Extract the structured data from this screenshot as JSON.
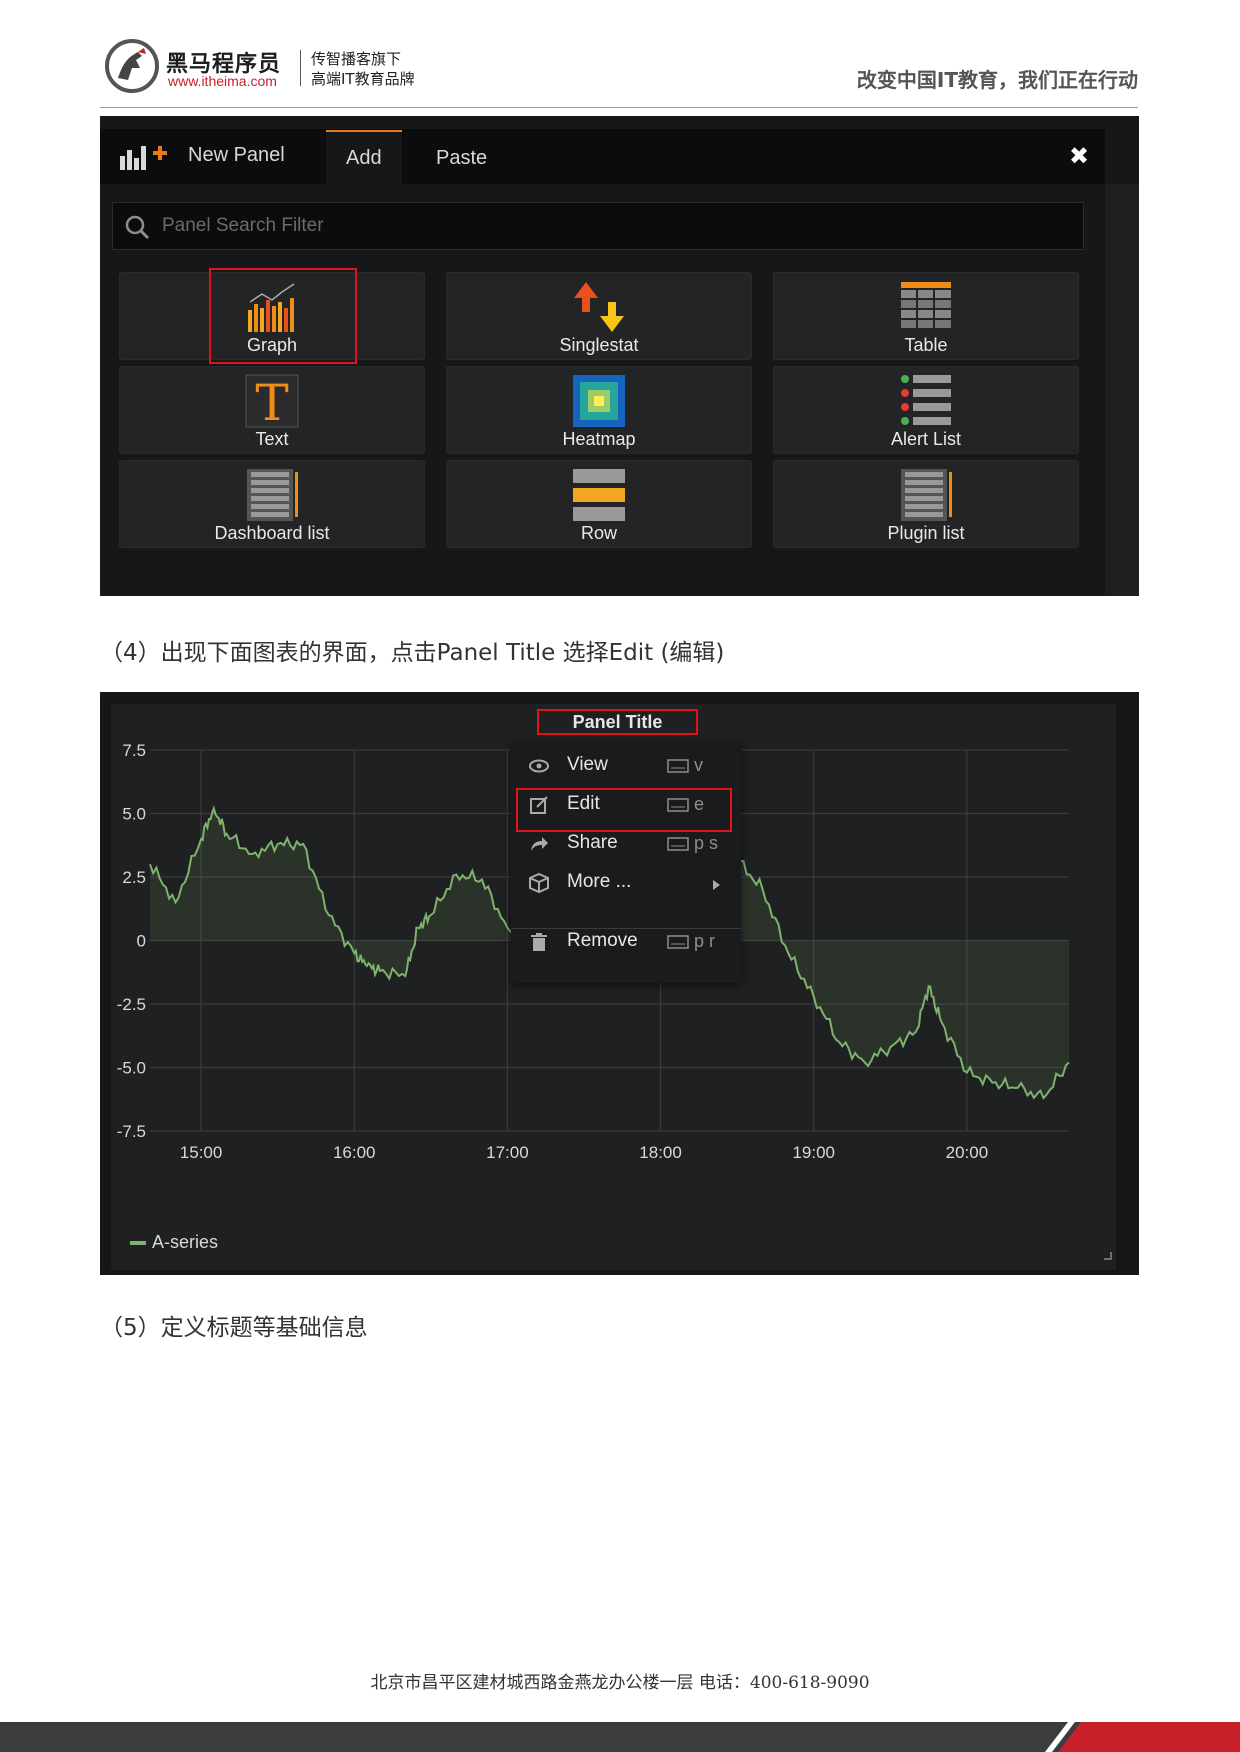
{
  "header": {
    "brand_name": "黑马程序员",
    "brand_url": "www.itheima.com",
    "brand_tag1": "传智播客旗下",
    "brand_tag2": "高端IT教育品牌",
    "slogan": "改变中国IT教育，我们正在行动"
  },
  "panel_picker": {
    "title": "New Panel",
    "tabs": [
      "Add",
      "Paste"
    ],
    "active_tab": "Add",
    "close_glyph": "✖",
    "search_placeholder": "Panel Search Filter",
    "tiles": [
      "Graph",
      "Singlestat",
      "Table",
      "Text",
      "Heatmap",
      "Alert List",
      "Dashboard list",
      "Row",
      "Plugin list"
    ],
    "highlighted_tile": "Graph"
  },
  "caption1": "（4）出现下面图表的界面，点击Panel Title  选择Edit (编辑)",
  "graph_panel": {
    "title": "Panel Title",
    "menu": [
      {
        "label": "View",
        "shortcut": "v",
        "icon": "eye-icon"
      },
      {
        "label": "Edit",
        "shortcut": "e",
        "icon": "edit-icon"
      },
      {
        "label": "Share",
        "shortcut": "p s",
        "icon": "share-icon"
      },
      {
        "label": "More ...",
        "shortcut": "",
        "icon": "cube-icon"
      },
      {
        "label": "Remove",
        "shortcut": "p r",
        "icon": "trash-icon"
      }
    ],
    "highlighted_item": "Edit",
    "colors": {
      "series": "#7eb26d",
      "highlight": "#e0121a",
      "accent": "#eb7b18"
    }
  },
  "chart_data": {
    "type": "line",
    "x_ticks": [
      "15:00",
      "16:00",
      "17:00",
      "18:00",
      "19:00",
      "20:00"
    ],
    "y_ticks": [
      "7.5",
      "5.0",
      "2.5",
      "0",
      "-2.5",
      "-5.0",
      "-7.5"
    ],
    "ylim": [
      -7.5,
      7.5
    ],
    "xlim": [
      "14:40",
      "20:40"
    ],
    "grid": true,
    "legend_position": "bottom-left",
    "series": [
      {
        "name": "A-series",
        "x": [
          "14:40",
          "14:50",
          "15:00",
          "15:05",
          "15:10",
          "15:20",
          "15:30",
          "15:40",
          "15:50",
          "16:00",
          "16:05",
          "16:10",
          "16:20",
          "16:25",
          "16:30",
          "16:40",
          "16:50",
          "17:00",
          "17:10",
          "17:20",
          "17:30",
          "17:40",
          "17:50",
          "18:00",
          "18:10",
          "18:20",
          "18:30",
          "18:40",
          "18:50",
          "19:00",
          "19:10",
          "19:20",
          "19:30",
          "19:40",
          "19:45",
          "19:50",
          "20:00",
          "20:10",
          "20:20",
          "20:30",
          "20:40"
        ],
        "values": [
          3.0,
          1.5,
          4.0,
          5.2,
          4.2,
          3.4,
          3.8,
          3.8,
          1.0,
          -0.5,
          -1.0,
          -1.2,
          -1.4,
          0.5,
          1.0,
          2.6,
          2.4,
          0.5,
          0.6,
          0.8,
          1.0,
          2.0,
          3.0,
          3.5,
          3.6,
          3.8,
          3.2,
          2.0,
          -0.5,
          -2.2,
          -4.0,
          -4.8,
          -4.2,
          -3.6,
          -1.8,
          -3.2,
          -5.2,
          -5.6,
          -5.8,
          -6.2,
          -4.8
        ]
      }
    ]
  },
  "caption2": "（5）定义标题等基础信息",
  "footer": {
    "address": "北京市昌平区建材城西路金燕龙办公楼一层        电话：400-618-9090"
  }
}
